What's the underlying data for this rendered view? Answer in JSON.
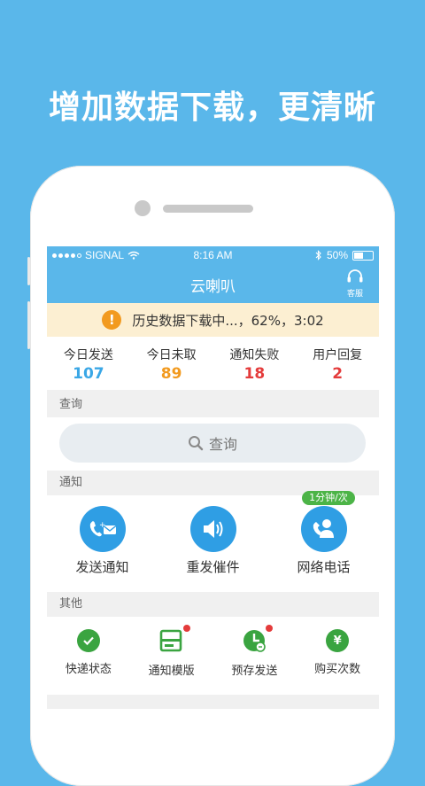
{
  "headline": "增加数据下载，更清晰",
  "status_bar": {
    "carrier": "SIGNAL",
    "time": "8:16 AM",
    "battery": "50%",
    "battery_level": 0.5
  },
  "nav": {
    "title": "云喇叭",
    "kefu_label": "客服"
  },
  "progress_banner": {
    "text": "历史数据下载中...，62%，3:02"
  },
  "stats": [
    {
      "label": "今日发送",
      "value": "107",
      "color": "#3aa7e6"
    },
    {
      "label": "今日未取",
      "value": "89",
      "color": "#f29a1f"
    },
    {
      "label": "通知失败",
      "value": "18",
      "color": "#e43b3b"
    },
    {
      "label": "用户回复",
      "value": "2",
      "color": "#e43b3b"
    }
  ],
  "sections": {
    "query": "查询",
    "notify": "通知",
    "other": "其他"
  },
  "search": {
    "placeholder": "查询"
  },
  "notify_actions": [
    {
      "label": "发送通知",
      "icon": "phone-mail-icon"
    },
    {
      "label": "重发催件",
      "icon": "speaker-icon"
    },
    {
      "label": "网络电话",
      "icon": "person-phone-icon"
    }
  ],
  "rate_badge": "1分钟/次",
  "other_actions": [
    {
      "label": "快递状态",
      "icon": "check-circle-icon"
    },
    {
      "label": "通知模版",
      "icon": "template-icon"
    },
    {
      "label": "预存发送",
      "icon": "clock-icon"
    },
    {
      "label": "购买次数",
      "icon": "yen-icon"
    }
  ],
  "colors": {
    "brand_blue": "#5ab7ea",
    "action_blue": "#2f9ee4",
    "green": "#3aa440",
    "warning": "#f29a1f",
    "alert_red": "#e43b3b"
  }
}
